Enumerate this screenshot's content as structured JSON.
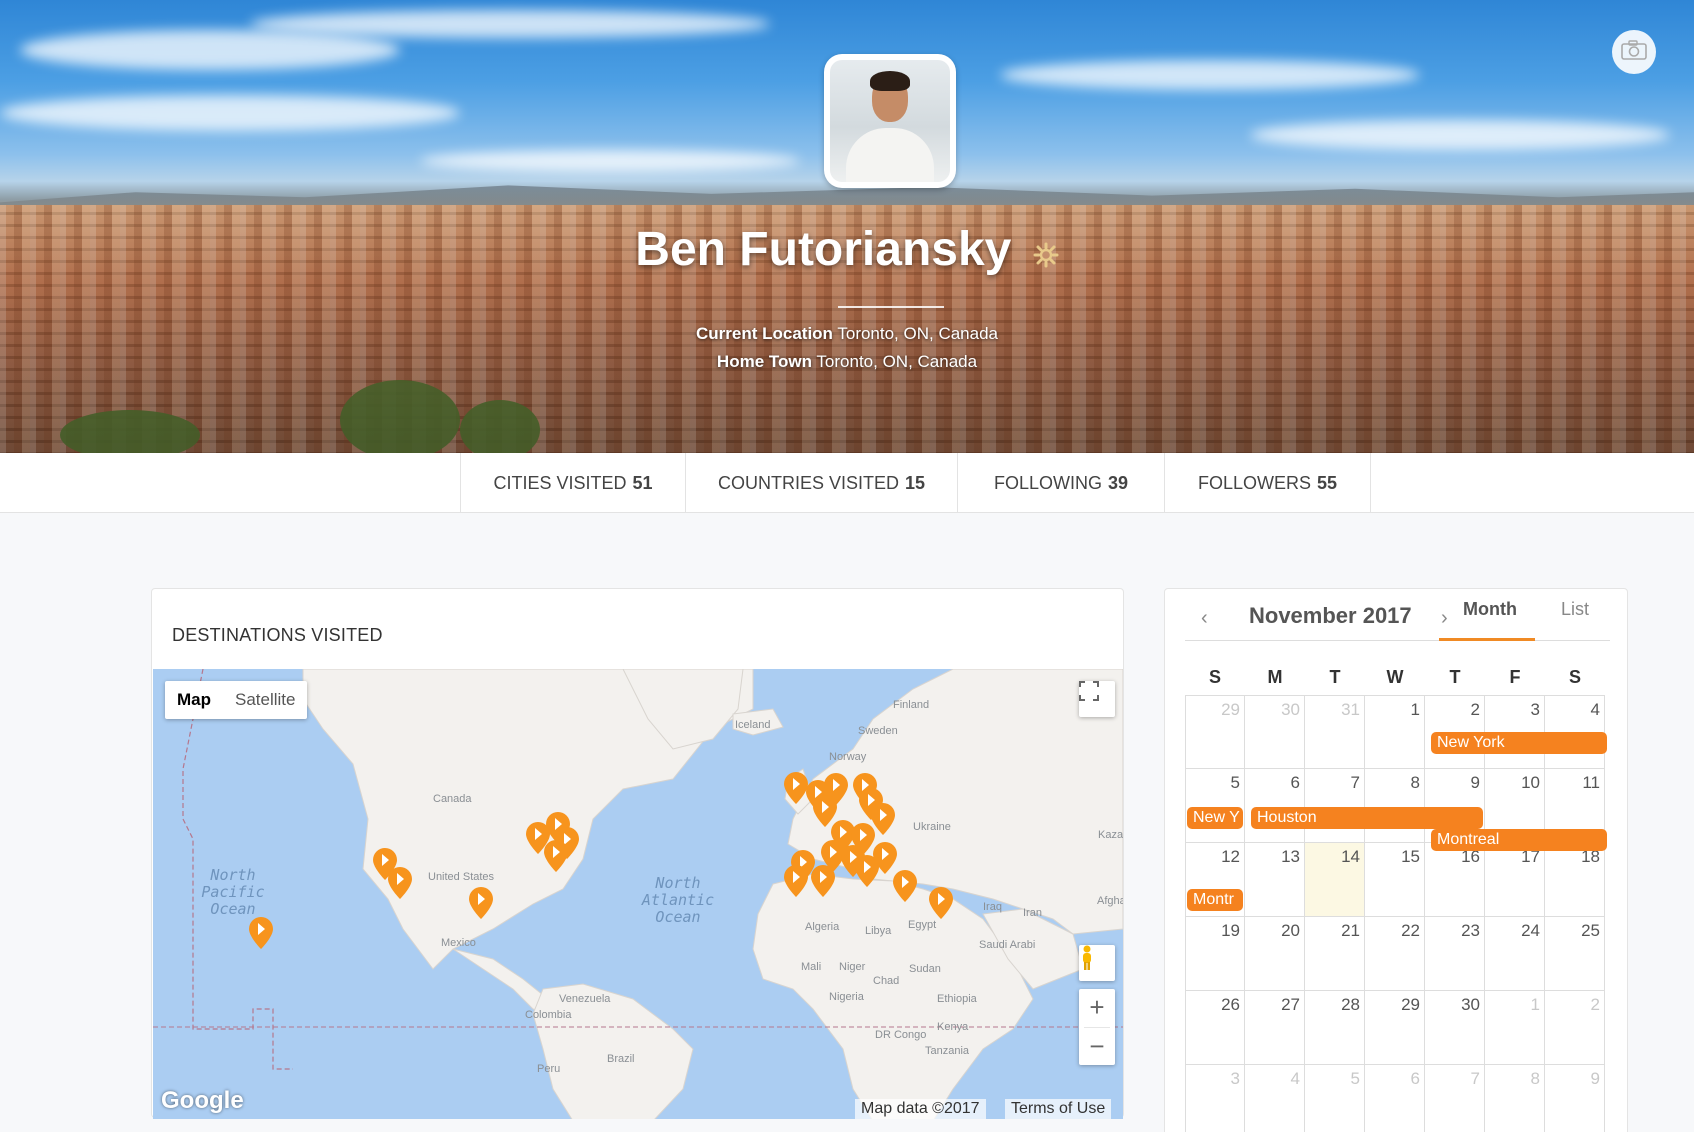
{
  "profile": {
    "name": "Ben Futoriansky",
    "current_location_label": "Current Location",
    "current_location": "Toronto, ON, Canada",
    "home_town_label": "Home Town",
    "home_town": "Toronto, ON, Canada"
  },
  "stats": [
    {
      "label": "CITIES VISITED",
      "value": "51"
    },
    {
      "label": "COUNTRIES VISITED",
      "value": "15"
    },
    {
      "label": "FOLLOWING",
      "value": "39"
    },
    {
      "label": "FOLLOWERS",
      "value": "55"
    }
  ],
  "destinations": {
    "title": "DESTINATIONS VISITED",
    "map_types": [
      "Map",
      "Satellite"
    ],
    "map_data_text": "Map data ©2017",
    "terms_text": "Terms of Use",
    "google_logo": "Google",
    "oceans": [
      "North Pacific Ocean",
      "North Atlantic Ocean"
    ],
    "countries": [
      "Iceland",
      "Finland",
      "Sweden",
      "Norway",
      "Canada",
      "United States",
      "Mexico",
      "Ukraine",
      "Kazal",
      "Algeria",
      "Libya",
      "Egypt",
      "Iraq",
      "Iran",
      "Afgha",
      "Saudi Arabi",
      "Mali",
      "Niger",
      "Chad",
      "Sudan",
      "Nigeria",
      "Ethiopia",
      "Kenya",
      "DR Congo",
      "Tanzania",
      "Venezuela",
      "Colombia",
      "Peru",
      "Brazil"
    ],
    "marker_color": "#f7941d"
  },
  "calendar": {
    "month_title": "November 2017",
    "tabs": [
      "Month",
      "List"
    ],
    "days_of_week": [
      "S",
      "M",
      "T",
      "W",
      "T",
      "F",
      "S"
    ],
    "weeks": [
      [
        "29",
        "30",
        "31",
        "1",
        "2",
        "3",
        "4"
      ],
      [
        "5",
        "6",
        "7",
        "8",
        "9",
        "10",
        "11"
      ],
      [
        "12",
        "13",
        "14",
        "15",
        "16",
        "17",
        "18"
      ],
      [
        "19",
        "20",
        "21",
        "22",
        "23",
        "24",
        "25"
      ],
      [
        "26",
        "27",
        "28",
        "29",
        "30",
        "1",
        "2"
      ],
      [
        "3",
        "4",
        "5",
        "6",
        "7",
        "8",
        "9"
      ]
    ],
    "today": "14",
    "event_color": "#f5821f",
    "events": [
      {
        "label": "New York"
      },
      {
        "label": "New Y"
      },
      {
        "label": "Houston"
      },
      {
        "label": "Montreal"
      },
      {
        "label": "Montr"
      }
    ]
  },
  "icons": {
    "camera": "camera-icon",
    "gear": "gear-icon",
    "fullscreen": "fullscreen-icon",
    "pegman": "pegman-icon",
    "zoom_in": "plus-icon",
    "zoom_out": "minus-icon",
    "prev": "chevron-left-icon",
    "next": "chevron-right-icon",
    "marker": "map-marker-icon"
  }
}
